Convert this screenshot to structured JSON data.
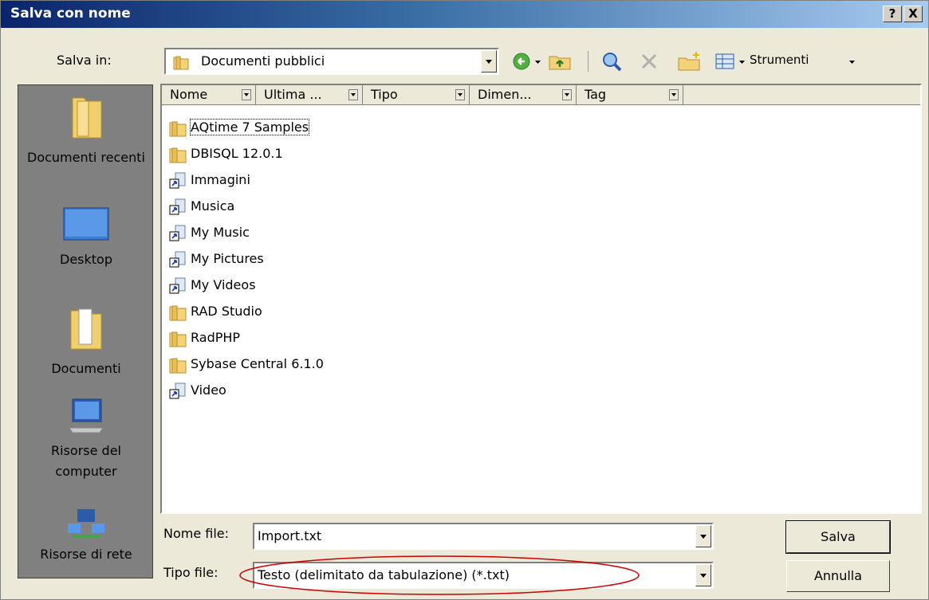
{
  "window": {
    "title": "Salva con nome",
    "help_btn": "?",
    "close_btn": "X"
  },
  "save_in": {
    "label": "Salva in:",
    "value": "Documenti pubblici"
  },
  "toolbar": {
    "tools_label": "Strumenti"
  },
  "places": [
    {
      "label": "Documenti recenti",
      "icon": "recent-documents-icon"
    },
    {
      "label": "Desktop",
      "icon": "desktop-icon"
    },
    {
      "label": "Documenti",
      "icon": "documents-icon"
    },
    {
      "label": "Risorse del computer",
      "icon": "my-computer-icon"
    },
    {
      "label": "Risorse di rete",
      "icon": "network-icon"
    }
  ],
  "columns": [
    "Nome",
    "Ultima ...",
    "Tipo",
    "Dimen...",
    "Tag"
  ],
  "files": [
    {
      "name": "AQtime 7 Samples",
      "type": "folder"
    },
    {
      "name": "DBISQL 12.0.1",
      "type": "folder"
    },
    {
      "name": "Immagini",
      "type": "shortcut"
    },
    {
      "name": "Musica",
      "type": "shortcut"
    },
    {
      "name": "My Music",
      "type": "shortcut"
    },
    {
      "name": "My Pictures",
      "type": "shortcut"
    },
    {
      "name": "My Videos",
      "type": "shortcut"
    },
    {
      "name": "RAD Studio",
      "type": "folder"
    },
    {
      "name": "RadPHP",
      "type": "folder"
    },
    {
      "name": "Sybase Central 6.1.0",
      "type": "folder"
    },
    {
      "name": "Video",
      "type": "shortcut"
    }
  ],
  "filename": {
    "label": "Nome file:",
    "value": "Import.txt"
  },
  "filetype": {
    "label": "Tipo file:",
    "value": "Testo (delimitato da tabulazione) (*.txt)"
  },
  "buttons": {
    "save": "Salva",
    "cancel": "Annulla"
  },
  "colors": {
    "title_start": "#0a246a",
    "title_end": "#a6caf0",
    "dialog_bg": "#ece9d8",
    "places_bg": "#808080",
    "highlight_ellipse": "#cc0000"
  }
}
